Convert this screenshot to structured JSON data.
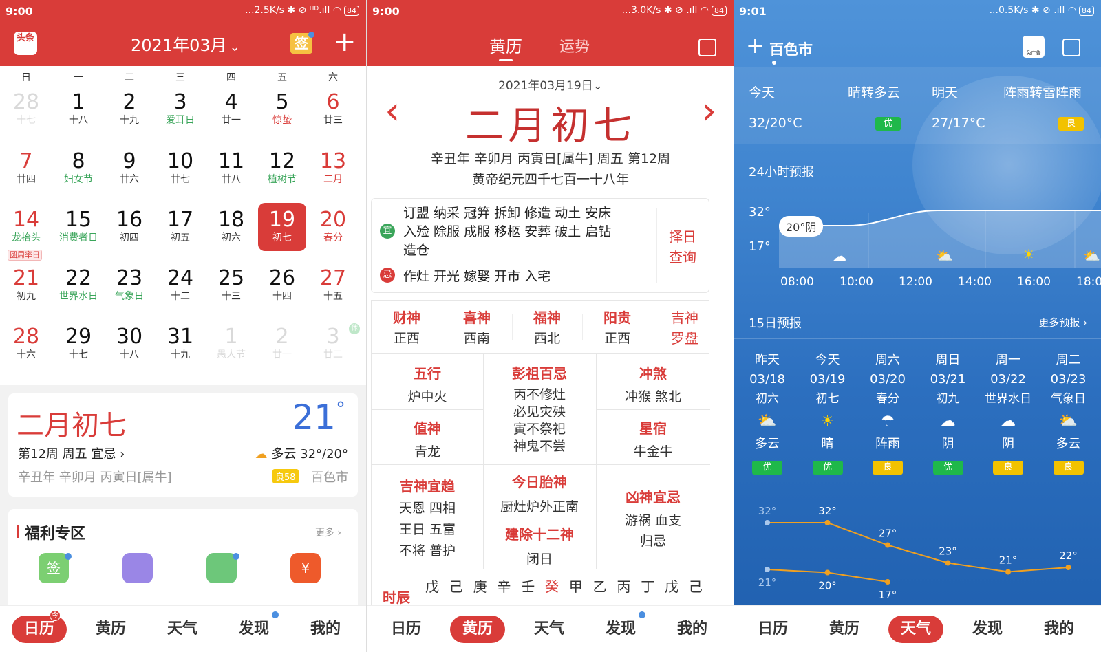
{
  "panel1": {
    "status": {
      "time": "9:00",
      "right": "...2.5K/s ✱ ⊘ ᴴᴰ.ıll ◠",
      "battery": "84"
    },
    "header": {
      "logo": "头条",
      "month": "2021年03月",
      "chev": "⌄",
      "sign": "签",
      "add": "+"
    },
    "weekdays": [
      "日",
      "一",
      "二",
      "三",
      "四",
      "五",
      "六"
    ],
    "days": [
      {
        "n": "28",
        "s": "十七",
        "t": "dim"
      },
      {
        "n": "1",
        "s": "十八",
        "t": ""
      },
      {
        "n": "2",
        "s": "十九",
        "t": ""
      },
      {
        "n": "3",
        "s": "爱耳日",
        "t": "grn"
      },
      {
        "n": "4",
        "s": "廿一",
        "t": ""
      },
      {
        "n": "5",
        "s": "惊蛰",
        "t": "redsub"
      },
      {
        "n": "6",
        "s": "廿三",
        "t": "rednum"
      },
      {
        "n": "7",
        "s": "廿四",
        "t": "rednum"
      },
      {
        "n": "8",
        "s": "妇女节",
        "t": "grn"
      },
      {
        "n": "9",
        "s": "廿六",
        "t": ""
      },
      {
        "n": "10",
        "s": "廿七",
        "t": ""
      },
      {
        "n": "11",
        "s": "廿八",
        "t": ""
      },
      {
        "n": "12",
        "s": "植树节",
        "t": "grn"
      },
      {
        "n": "13",
        "s": "二月",
        "t": "red"
      },
      {
        "n": "14",
        "s": "龙抬头",
        "t": "red14"
      },
      {
        "n": "15",
        "s": "消费者日",
        "t": "grn"
      },
      {
        "n": "16",
        "s": "初四",
        "t": ""
      },
      {
        "n": "17",
        "s": "初五",
        "t": ""
      },
      {
        "n": "18",
        "s": "初六",
        "t": ""
      },
      {
        "n": "19",
        "s": "初七",
        "t": "today"
      },
      {
        "n": "20",
        "s": "春分",
        "t": "red"
      },
      {
        "n": "21",
        "s": "初九",
        "t": "rednum"
      },
      {
        "n": "22",
        "s": "世界水日",
        "t": "grn"
      },
      {
        "n": "23",
        "s": "气象日",
        "t": "grn"
      },
      {
        "n": "24",
        "s": "十二",
        "t": ""
      },
      {
        "n": "25",
        "s": "十三",
        "t": ""
      },
      {
        "n": "26",
        "s": "十四",
        "t": ""
      },
      {
        "n": "27",
        "s": "十五",
        "t": "rednum"
      },
      {
        "n": "28",
        "s": "十六",
        "t": "rednum"
      },
      {
        "n": "29",
        "s": "十七",
        "t": ""
      },
      {
        "n": "30",
        "s": "十八",
        "t": ""
      },
      {
        "n": "31",
        "s": "十九",
        "t": ""
      },
      {
        "n": "1",
        "s": "愚人节",
        "t": "dim"
      },
      {
        "n": "2",
        "s": "廿一",
        "t": "dim"
      },
      {
        "n": "3",
        "s": "廿二",
        "t": "dim"
      }
    ],
    "pi_day": "圆周率日",
    "corner_badge": "休",
    "info": {
      "lunar": "二月初七",
      "temp": "21",
      "deg": "°",
      "week": "第12周 周五 宜忌 ›",
      "weather": "多云 32°/20°",
      "ganzhi": "辛丑年 辛卯月 丙寅日[属牛]",
      "aqi": "良58",
      "city": "百色市"
    },
    "welfare": {
      "title": "福利专区",
      "more": "更多 ›",
      "icon1": "签"
    },
    "tabs": [
      "日历",
      "黄历",
      "天气",
      "发现",
      "我的"
    ],
    "badge": "今"
  },
  "panel2": {
    "status": {
      "time": "9:00",
      "right": "...3.0K/s ✱ ⊘ .ıll ◠",
      "battery": "84"
    },
    "tabs": {
      "a": "黄历",
      "b": "运势"
    },
    "date": "2021年03月19日",
    "chev": "⌄",
    "prev": "‹",
    "next": "›",
    "lunar": "二月初七",
    "line1": "辛丑年 辛卯月 丙寅日[属牛] 周五 第12周",
    "line2": "黄帝纪元四千七百一十八年",
    "yi_mark": "宜",
    "ji_mark": "忌",
    "yi": [
      "订盟 纳采 冠笄 拆卸 修造 动土 安床",
      "入殓 除服 成服 移柩 安葬 破土 启钻",
      "造仓"
    ],
    "ji": "作灶 开光 嫁娶 开市 入宅",
    "zeri": [
      "择日",
      "查询"
    ],
    "gods": [
      {
        "l": "财神",
        "v": "正西"
      },
      {
        "l": "喜神",
        "v": "西南"
      },
      {
        "l": "福神",
        "v": "西北"
      },
      {
        "l": "阳贵",
        "v": "正西"
      }
    ],
    "jishen": {
      "l": "吉神",
      "v": "罗盘"
    },
    "wuxing": {
      "l": "五行",
      "v": "炉中火"
    },
    "pengzu": {
      "l": "彭祖百忌",
      "v": [
        "丙不修灶",
        "必见灾殃",
        "寅不祭祀",
        "神鬼不尝"
      ]
    },
    "chongsha": {
      "l": "冲煞",
      "v": "冲猴 煞北"
    },
    "zhishen": {
      "l": "值神",
      "v": "青龙"
    },
    "xingxiu": {
      "l": "星宿",
      "v": "牛金牛"
    },
    "jishenyi": {
      "l": "吉神宜趋",
      "v": [
        "天恩 四相",
        "王日 五富",
        "不将 普护"
      ]
    },
    "taishen": {
      "l": "今日胎神",
      "v": "厨灶炉外正南"
    },
    "jianchu": {
      "l": "建除十二神",
      "v": "闭日"
    },
    "xiongshen": {
      "l": "凶神宜忌",
      "v": [
        "游祸 血支",
        "归忌"
      ]
    },
    "shichen_label": "时辰",
    "shichen": [
      "戊",
      "己",
      "庚",
      "辛",
      "壬",
      "癸",
      "甲",
      "乙",
      "丙",
      "丁",
      "戊",
      "己"
    ],
    "tabsbar": [
      "日历",
      "黄历",
      "天气",
      "发现",
      "我的"
    ]
  },
  "panel3": {
    "status": {
      "time": "9:01",
      "right": "...0.5K/s ✱ ⊘ .ıll ◠",
      "battery": "84"
    },
    "city": "百色市",
    "add": "+",
    "ad_label": "免广告",
    "today": {
      "l": "今天",
      "w": "晴转多云",
      "t": "32/20°C",
      "q": "优"
    },
    "tomorrow": {
      "l": "明天",
      "w": "阵雨转雷阵雨",
      "t": "27/17°C",
      "q": "良"
    },
    "hourly_title": "24小时预报",
    "hourly": {
      "hi": "32°",
      "lo": "17°",
      "tip": "20°阴",
      "times": [
        "08:00",
        "10:00",
        "12:00",
        "14:00",
        "16:00",
        "18:0"
      ]
    },
    "daily_title": "15日预报",
    "daily_more": "更多预报 ›",
    "days": [
      {
        "d": "昨天",
        "dt": "03/18",
        "l": "初六",
        "w": "多云",
        "q": "优",
        "qc": "#1fb84a",
        "icon": "cloud-sun"
      },
      {
        "d": "今天",
        "dt": "03/19",
        "l": "初七",
        "w": "晴",
        "q": "优",
        "qc": "#1fb84a",
        "icon": "sun"
      },
      {
        "d": "周六",
        "dt": "03/20",
        "l": "春分",
        "w": "阵雨",
        "q": "良",
        "qc": "#f2c200",
        "icon": "rain"
      },
      {
        "d": "周日",
        "dt": "03/21",
        "l": "初九",
        "w": "阴",
        "q": "优",
        "qc": "#1fb84a",
        "icon": "cloud"
      },
      {
        "d": "周一",
        "dt": "03/22",
        "l": "世界水日",
        "w": "阴",
        "q": "良",
        "qc": "#f2c200",
        "icon": "cloud"
      },
      {
        "d": "周二",
        "dt": "03/23",
        "l": "气象日",
        "w": "多云",
        "q": "良",
        "qc": "#f2c200",
        "icon": "cloud-sun"
      }
    ],
    "chart_data": {
      "type": "line",
      "x": [
        "昨天",
        "今天",
        "周六",
        "周日",
        "周一",
        "周二"
      ],
      "series": [
        {
          "name": "",
          "values": [
            32,
            32,
            27,
            23,
            21,
            22
          ]
        },
        {
          "name": "",
          "values": [
            21,
            20,
            17,
            null,
            null,
            null
          ]
        }
      ]
    },
    "hi_labels": [
      "32°",
      "32°",
      "27°",
      "23°",
      "21°",
      "22°"
    ],
    "lo_labels": [
      "21°",
      "20°",
      "17°"
    ],
    "tabsbar": [
      "日历",
      "黄历",
      "天气",
      "发现",
      "我的"
    ]
  }
}
